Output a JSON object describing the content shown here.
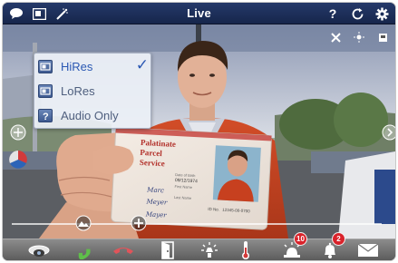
{
  "header": {
    "title": "Live",
    "help_symbol": "?"
  },
  "quality_menu": {
    "items": [
      {
        "label": "HiRes",
        "selected": true
      },
      {
        "label": "LoRes",
        "selected": false
      },
      {
        "label": "Audio Only",
        "selected": false
      }
    ],
    "check_symbol": "✓"
  },
  "id_card": {
    "header_line1": "Palatinate",
    "header_line2": "Parcel",
    "header_line3": "Service",
    "first_name_label": "First Name",
    "first_name": "Marc",
    "last_name_label": "Last Name",
    "last_name": "Meyer",
    "birth_label": "Date of Birth",
    "birth_value": "09/12/1974",
    "license_label": "ID No.",
    "license_value": "12345-00-0700",
    "signature": "Mayer"
  },
  "toolbar": {
    "items": [
      {
        "name": "camera-dome",
        "icon": "camera-dome-icon"
      },
      {
        "name": "call",
        "icon": "phone-accept-icon",
        "color": "#5fbf4a"
      },
      {
        "name": "hangup",
        "icon": "phone-hangup-icon",
        "color": "#e0545a"
      },
      {
        "name": "door",
        "icon": "door-open-icon"
      },
      {
        "name": "light",
        "icon": "light-icon"
      },
      {
        "name": "temperature",
        "icon": "thermometer-icon"
      },
      {
        "name": "alarm",
        "icon": "alarm-light-icon",
        "badge": "10"
      },
      {
        "name": "notifications",
        "icon": "bell-icon",
        "badge": "2"
      },
      {
        "name": "messages",
        "icon": "envelope-icon"
      }
    ]
  }
}
